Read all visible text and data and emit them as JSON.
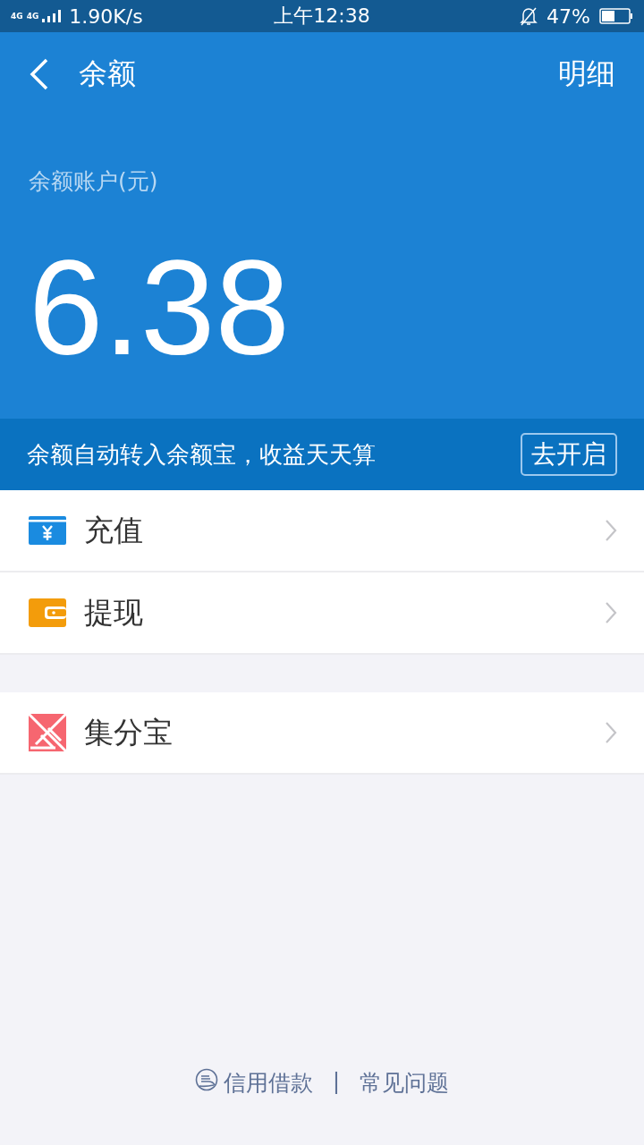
{
  "status_bar": {
    "network": "4G",
    "network_2": "4G",
    "speed": "1.90K/s",
    "time": "上午12:38",
    "battery": "47%"
  },
  "header": {
    "title": "余额",
    "action": "明细"
  },
  "balance": {
    "label": "余额账户(元)",
    "amount": "6.38"
  },
  "banner": {
    "text": "余额自动转入余额宝，收益天天算",
    "button": "去开启"
  },
  "groups": [
    {
      "items": [
        {
          "kind": "recharge",
          "label": "充值"
        },
        {
          "kind": "withdraw",
          "label": "提现"
        }
      ]
    },
    {
      "items": [
        {
          "kind": "points",
          "label": "集分宝"
        }
      ]
    }
  ],
  "footer": {
    "links": [
      {
        "label": "信用借款",
        "icon": true
      },
      {
        "label": "常见问题",
        "icon": false
      }
    ],
    "separator": "|"
  }
}
